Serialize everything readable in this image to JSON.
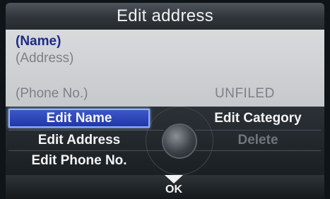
{
  "title": "Edit address",
  "info": {
    "name": "(Name)",
    "address": "(Address)",
    "phone": "(Phone No.)",
    "category": "UNFILED"
  },
  "menu": {
    "left": [
      {
        "label": "Edit Name",
        "selected": true
      },
      {
        "label": "Edit Address",
        "selected": false
      },
      {
        "label": "Edit Phone No.",
        "selected": false
      }
    ],
    "right": [
      {
        "label": "Edit Category",
        "enabled": true
      },
      {
        "label": "Delete",
        "enabled": false
      }
    ]
  },
  "footer": {
    "ok_label": "OK",
    "ok_icon": "down-arrow-icon"
  },
  "colors": {
    "selected_button": "#2a44b8",
    "name_text": "#1d2b8a",
    "disabled_text": "#6f767c"
  }
}
